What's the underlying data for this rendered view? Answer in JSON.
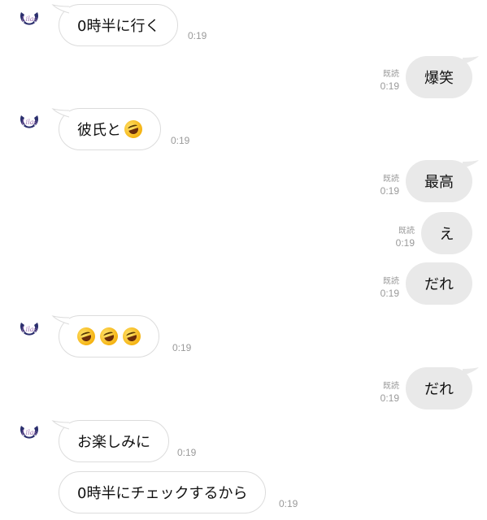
{
  "messages": [
    {
      "side": "in",
      "avatar": true,
      "text": "0時半に行く",
      "time": "0:19"
    },
    {
      "side": "out",
      "text": "爆笑",
      "read": "既読",
      "time": "0:19"
    },
    {
      "side": "in",
      "avatar": true,
      "text": "彼氏と",
      "emoji_count": 1,
      "time": "0:19"
    },
    {
      "side": "out",
      "text": "最高",
      "read": "既読",
      "time": "0:19"
    },
    {
      "side": "out",
      "text": "え",
      "read": "既読",
      "time": "0:19"
    },
    {
      "side": "out",
      "text": "だれ",
      "read": "既読",
      "time": "0:19"
    },
    {
      "side": "in",
      "avatar": true,
      "text": "",
      "emoji_count": 3,
      "time": "0:19"
    },
    {
      "side": "out",
      "text": "だれ",
      "read": "既読",
      "time": "0:19"
    },
    {
      "side": "in",
      "avatar": true,
      "text": "お楽しみに",
      "time": "0:19"
    },
    {
      "side": "in",
      "avatar": false,
      "text": "0時半にチェックするから",
      "time": "0:19"
    }
  ],
  "avatar_logo": "Lilas",
  "icons": {
    "avatar": "horseshoe-logo-icon",
    "emoji": "rolling-on-floor-laughing-emoji-icon"
  },
  "colors": {
    "incoming_bubble": "#ffffff",
    "outgoing_bubble": "#e9e9e9",
    "meta_text": "#9a9a9a",
    "avatar_navy": "#2b2f6e"
  }
}
